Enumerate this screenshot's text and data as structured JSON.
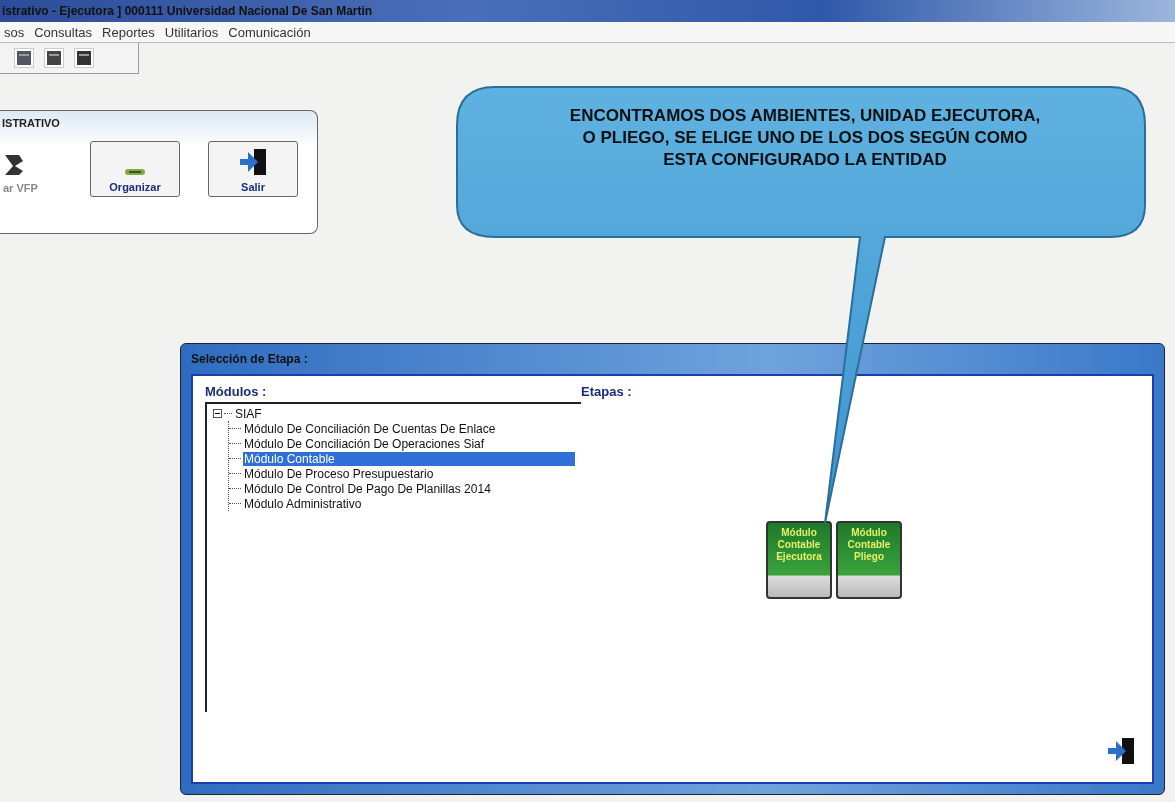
{
  "window": {
    "title": "istrativo - Ejecutora ] 000111 Universidad Nacional De San Martin"
  },
  "menu": [
    "sos",
    "Consultas",
    "Reportes",
    "Utilitarios",
    "Comunicación"
  ],
  "panel": {
    "title": "ISTRATIVO",
    "buttons": [
      {
        "label": "ar VFP",
        "kind": "back"
      },
      {
        "label": "Organizar",
        "kind": "organize"
      },
      {
        "label": "Salir",
        "kind": "exit"
      }
    ]
  },
  "callout": {
    "text": "ENCONTRAMOS DOS AMBIENTES, UNIDAD EJECUTORA,\nO PLIEGO, SE ELIGE UNO DE LOS DOS SEGÚN COMO\nESTA CONFIGURADO LA ENTIDAD"
  },
  "dialog": {
    "title": "Selección de Etapa :",
    "modules_label": "Módulos :",
    "stages_label": "Etapas :",
    "tree": [
      {
        "label": "SIAF",
        "expanded": true,
        "children": [
          {
            "label": "Módulo De Conciliación De Cuentas De Enlace",
            "selected": false
          },
          {
            "label": "Módulo De Conciliación De Operaciones Siaf",
            "selected": false
          },
          {
            "label": "Módulo Contable",
            "selected": true
          },
          {
            "label": "Módulo De Proceso Presupuestario",
            "selected": false
          },
          {
            "label": "Módulo De Control De Pago De Planillas 2014",
            "selected": false
          },
          {
            "label": "Módulo Administrativo",
            "selected": false
          }
        ]
      }
    ],
    "stages": [
      {
        "text": "Módulo\nContable\nEjecutora"
      },
      {
        "text": "Módulo\nContable\nPliego"
      }
    ]
  }
}
